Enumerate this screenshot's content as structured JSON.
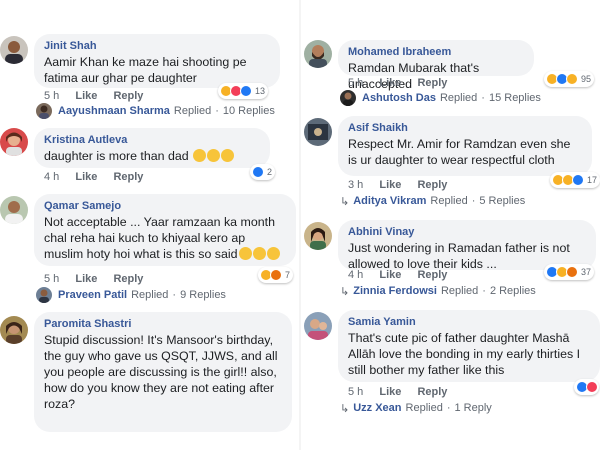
{
  "left": [
    {
      "author": "Jinit Shah",
      "text": "Aamir Khan ke maze hai shooting pe fatima aur ghar pe daughter",
      "time": "5 h",
      "like": "Like",
      "reply": "Reply",
      "reaction_count": "13",
      "reactions": [
        "haha",
        "love",
        "like"
      ],
      "replied_by": "Aayushmaan Sharma",
      "replied_word": "Replied",
      "replies": "10 Replies"
    },
    {
      "author": "Kristina Autleva",
      "text": "daughter is more than dad",
      "time": "4 h",
      "like": "Like",
      "reply": "Reply",
      "reaction_count": "2",
      "reactions": [
        "like"
      ]
    },
    {
      "author": "Qamar Samejo",
      "text": "Not acceptable ... Yaar ramzaan ka month chal reha hai kuch to khiyaal kero ap muslim hoty hoi what is this so said",
      "time": "5 h",
      "like": "Like",
      "reply": "Reply",
      "reaction_count": "7",
      "reactions": [
        "haha",
        "angry"
      ],
      "replied_by": "Praveen Patil",
      "replied_word": "Replied",
      "replies": "9 Replies"
    },
    {
      "author": "Paromita Shastri",
      "text": "Stupid discussion! It's Mansoor's birthday, the guy who gave us QSQT, JJWS, and all you people are discussing is the girl!! also, how do you know they are not eating after roza?"
    }
  ],
  "right": [
    {
      "author": "Mohamed Ibraheem",
      "text": "Ramdan Mubarak that's unaccepted",
      "time": "5 h",
      "like": "Like",
      "reply": "Reply",
      "reaction_count": "95",
      "reactions": [
        "haha",
        "like",
        "wow"
      ],
      "replied_by": "Ashutosh Das",
      "replied_word": "Replied",
      "replies": "15 Replies"
    },
    {
      "author": "Asif Shaikh",
      "text": "Respect Mr. Amir for Ramdzan even she is ur daughter to wear respectful cloth",
      "time": "3 h",
      "like": "Like",
      "reply": "Reply",
      "reaction_count": "17",
      "reactions": [
        "haha",
        "wow",
        "like"
      ],
      "replied_by": "Aditya Vikram",
      "replied_word": "Replied",
      "replies": "5 Replies"
    },
    {
      "author": "Abhini Vinay",
      "text": "Just wondering in Ramadan father is not allowed to love their kids ...",
      "time": "4 h",
      "like": "Like",
      "reply": "Reply",
      "reaction_count": "37",
      "reactions": [
        "like",
        "haha",
        "angry"
      ],
      "replied_by": "Zinnia Ferdowsi",
      "replied_word": "Replied",
      "replies": "2 Replies"
    },
    {
      "author": "Samia Yamin",
      "text": "That's cute pic of father daughter Mashā Allāh love the bonding in my early thirties I still bother my father like this",
      "time": "5 h",
      "like": "Like",
      "reply": "Reply",
      "reactions": [
        "like",
        "love"
      ],
      "replied_by": "Uzz Xean",
      "replied_word": "Replied",
      "replies": "1 Reply"
    }
  ],
  "colors": {
    "name": "#385898",
    "bubble": "#f2f3f5",
    "meta": "#606770",
    "like": "#2078f4",
    "haha": "#f7b125",
    "love": "#f33e58",
    "angry": "#e9710f"
  }
}
